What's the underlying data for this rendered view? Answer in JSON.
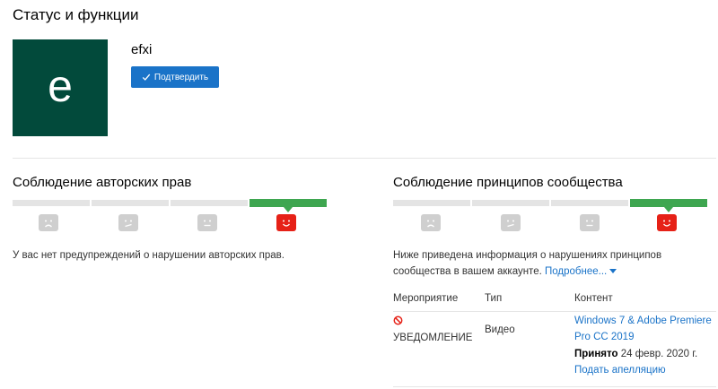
{
  "header": {
    "title": "Статус и функции"
  },
  "channel": {
    "avatar_letter": "e",
    "avatar_color": "#024a3b",
    "name": "efxi",
    "verify_label": "Подтвердить"
  },
  "copyright": {
    "title": "Соблюдение авторских прав",
    "status_index": 3,
    "message": "У вас нет предупреждений о нарушении авторских прав."
  },
  "community": {
    "title": "Соблюдение принципов сообщества",
    "status_index": 3,
    "message_line1": "Ниже приведена информация о нарушениях принципов",
    "message_line2": "сообщества в вашем аккаунте.",
    "more_label": "Подробнее...",
    "table": {
      "headers": {
        "event": "Мероприятие",
        "type": "Тип",
        "content": "Контент"
      },
      "rows": [
        {
          "event": "УВЕДОМЛЕНИЕ",
          "type": "Видео",
          "content_line1": "Windows 7 & Adobe Premiere",
          "content_line2": "Pro CC 2019",
          "accepted_label": "Принято",
          "accepted_date": "24 февр. 2020 г.",
          "appeal_label": "Подать апелляцию"
        }
      ]
    }
  },
  "colors": {
    "accent": "#1a73c8",
    "good": "#3ea650",
    "active_face": "#e62117",
    "inactive": "#cfcfcf"
  }
}
